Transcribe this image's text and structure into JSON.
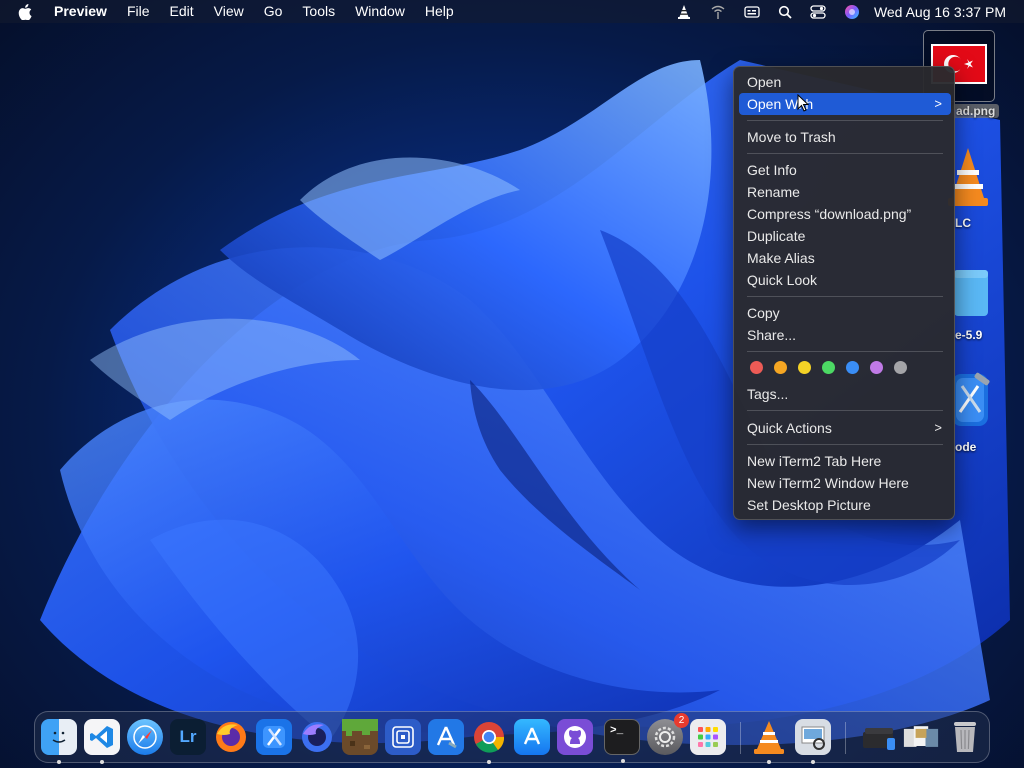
{
  "menubar": {
    "app_name": "Preview",
    "items": [
      "File",
      "Edit",
      "View",
      "Go",
      "Tools",
      "Window",
      "Help"
    ],
    "clock": "Wed Aug 16  3:37 PM",
    "status_icons": [
      "vlc-icon",
      "network-icon",
      "keyboard-input-icon",
      "search-icon",
      "control-center-icon",
      "siri-icon"
    ]
  },
  "desktop": {
    "icons": [
      {
        "name": "download.png",
        "label": "ad.png",
        "icon": "turkish-flag-image-icon",
        "selected": true
      },
      {
        "name": "VLC",
        "label": "LC",
        "icon": "vlc-cone-icon"
      },
      {
        "name": "folder",
        "label": "e-5.9",
        "icon": "folder-icon"
      },
      {
        "name": "Xcode",
        "label": "ode",
        "icon": "xcode-icon"
      }
    ]
  },
  "context_menu": {
    "items": [
      {
        "label": "Open"
      },
      {
        "label": "Open With",
        "highlighted": true,
        "submenu": true
      },
      {
        "label": "Move to Trash"
      },
      {
        "label": "Get Info"
      },
      {
        "label": "Rename"
      },
      {
        "label": "Compress “download.png”"
      },
      {
        "label": "Duplicate"
      },
      {
        "label": "Make Alias"
      },
      {
        "label": "Quick Look"
      },
      {
        "label": "Copy"
      },
      {
        "label": "Share..."
      },
      {
        "label": "Tags..."
      },
      {
        "label": "Quick Actions",
        "submenu": true
      },
      {
        "label": "New iTerm2 Tab Here"
      },
      {
        "label": "New iTerm2 Window Here"
      },
      {
        "label": "Set Desktop Picture"
      }
    ],
    "tag_colors": [
      "#ec5b56",
      "#f5a623",
      "#f4d226",
      "#4cd964",
      "#3a8ef6",
      "#c07ae6",
      "#a4a4a8"
    ],
    "submenu_glyph": ">"
  },
  "dock": {
    "apps": [
      {
        "name": "Finder",
        "icon": "finder-icon",
        "running": true
      },
      {
        "name": "Visual Studio Code",
        "icon": "vscode-icon",
        "running": true
      },
      {
        "name": "Safari",
        "icon": "safari-icon",
        "running": false
      },
      {
        "name": "Lightroom",
        "icon": "lightroom-icon",
        "label": "Lr",
        "running": false
      },
      {
        "name": "Firefox",
        "icon": "firefox-icon",
        "running": false
      },
      {
        "name": "Xcode",
        "icon": "xcode-icon",
        "running": false
      },
      {
        "name": "Firefox Developer",
        "icon": "firefox-dev-icon",
        "running": false
      },
      {
        "name": "Minecraft",
        "icon": "minecraft-icon",
        "running": false
      },
      {
        "name": "Screen Sharing",
        "icon": "screen-sharing-icon",
        "running": false
      },
      {
        "name": "Simulator",
        "icon": "app-store-dev-icon",
        "running": false
      },
      {
        "name": "Chrome",
        "icon": "chrome-icon",
        "running": true
      },
      {
        "name": "App Store",
        "icon": "app-store-icon",
        "running": false
      },
      {
        "name": "GitHub Desktop",
        "icon": "github-icon",
        "running": false
      },
      {
        "name": "Terminal",
        "icon": "terminal-icon",
        "label": ">_",
        "running": true
      },
      {
        "name": "System Settings",
        "icon": "system-settings-icon",
        "badge": "2",
        "running": false
      },
      {
        "name": "Launchpad",
        "icon": "launchpad-icon",
        "running": false
      },
      {
        "name": "VLC",
        "icon": "vlc-icon",
        "running": true
      },
      {
        "name": "Preview",
        "icon": "preview-icon",
        "running": true
      },
      {
        "name": "Downloads",
        "icon": "downloads-stack-icon",
        "running": false
      },
      {
        "name": "Documents",
        "icon": "documents-stack-icon",
        "running": false
      },
      {
        "name": "Trash",
        "icon": "trash-icon",
        "running": false
      }
    ]
  }
}
